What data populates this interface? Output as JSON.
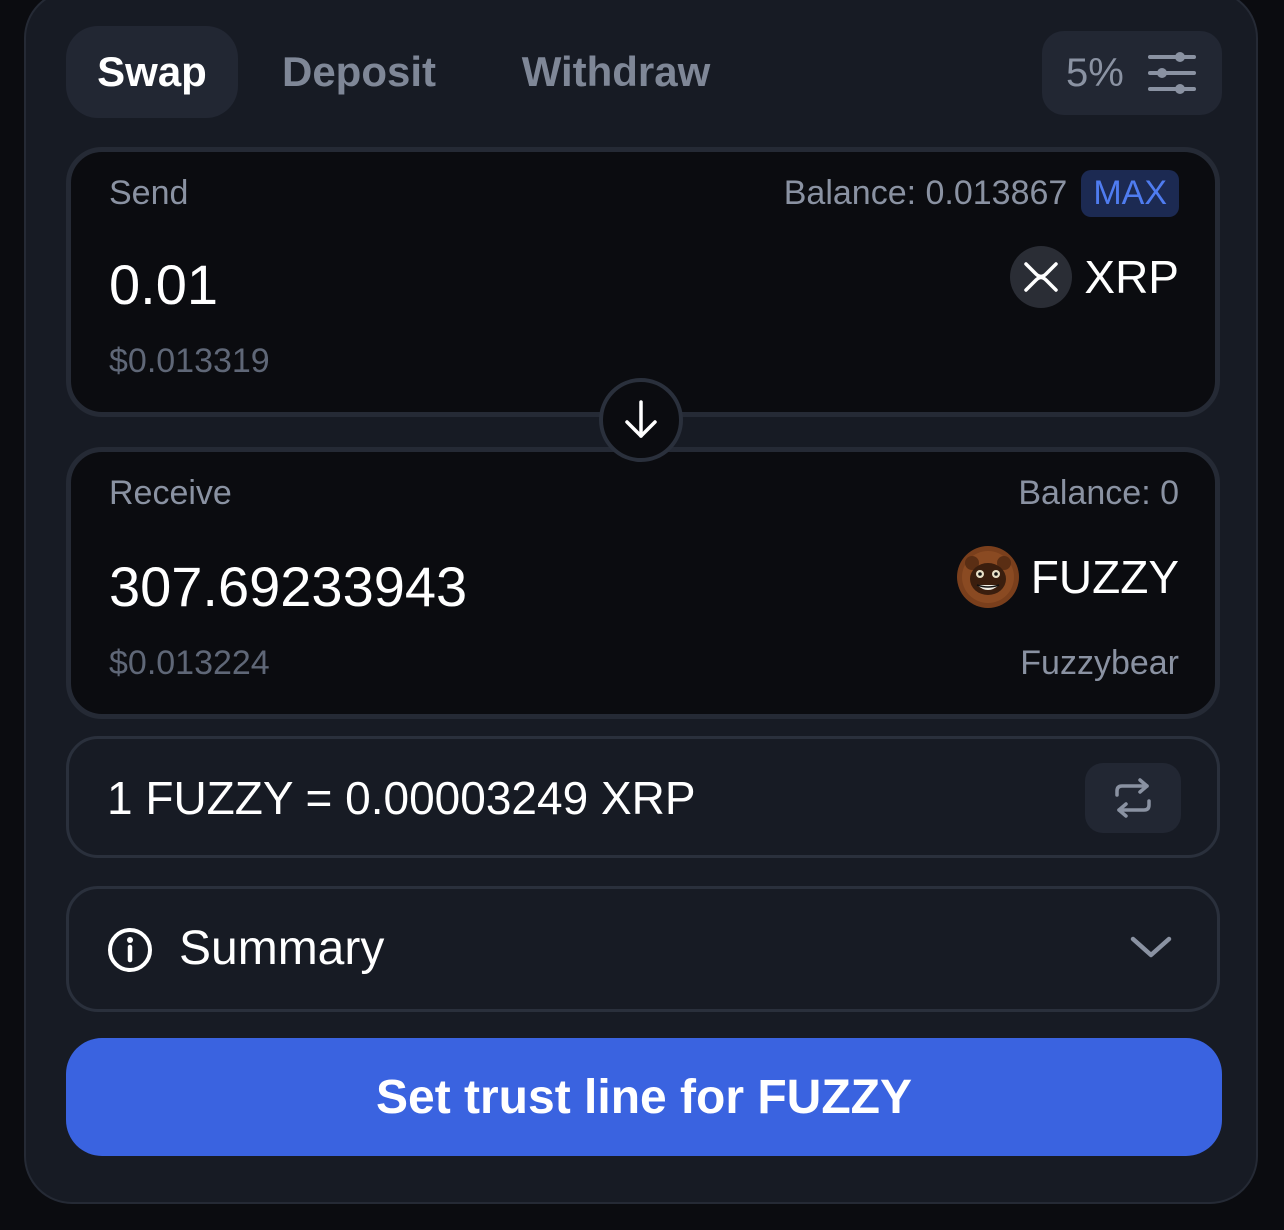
{
  "tabs": {
    "swap": "Swap",
    "deposit": "Deposit",
    "withdraw": "Withdraw",
    "active": "Swap"
  },
  "slippage": {
    "value": "5%",
    "icon": "sliders-icon"
  },
  "send": {
    "label": "Send",
    "balance": "Balance: 0.013867",
    "max_label": "MAX",
    "amount": "0.01",
    "usd": "$0.013319",
    "token": "XRP",
    "token_icon": "xrp-icon"
  },
  "swap_direction_icon": "arrow-down-icon",
  "receive": {
    "label": "Receive",
    "balance": "Balance: 0",
    "amount": "307.69233943",
    "usd": "$0.013224",
    "token": "FUZZY",
    "token_name": "Fuzzybear",
    "token_icon": "fuzzybear-icon"
  },
  "rate": {
    "text": "1 FUZZY = 0.00003249 XRP",
    "invert_icon": "swap-arrows-icon"
  },
  "summary": {
    "label": "Summary",
    "icon": "info-icon",
    "chevron": "chevron-down-icon"
  },
  "cta": {
    "label": "Set trust line for FUZZY"
  },
  "colors": {
    "background": "#171b24",
    "card": "#0b0c10",
    "accent": "#3a63e0",
    "max_bg": "#1c2a52",
    "max_text": "#4f7cf0"
  }
}
